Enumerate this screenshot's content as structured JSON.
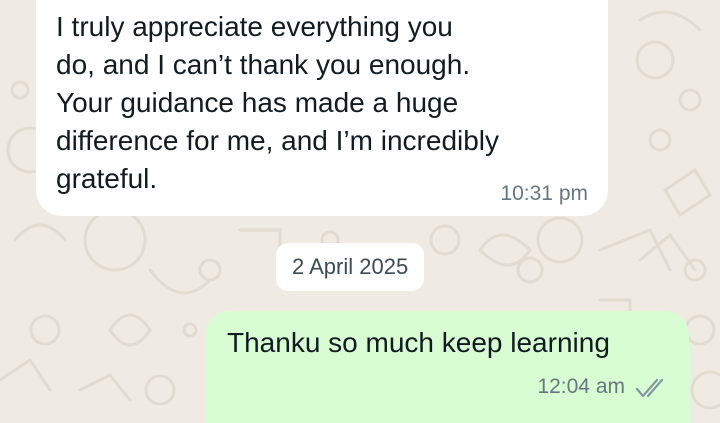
{
  "incoming_message": {
    "text": "I truly appreciate everything you\ndo, and I can’t thank you enough.\nYour guidance has made a huge\ndifference for me, and I’m incredibly\ngrateful.",
    "time": "10:31 pm"
  },
  "date_separator": "2 April 2025",
  "outgoing_message": {
    "text": "Thanku so much keep learning",
    "time": "12:04 am",
    "status_icon": "double-check-icon"
  },
  "colors": {
    "wallpaper": "#efeae2",
    "incoming_bubble": "#ffffff",
    "outgoing_bubble": "#d9fdd3",
    "text": "#111b21",
    "meta_text": "#667781"
  }
}
